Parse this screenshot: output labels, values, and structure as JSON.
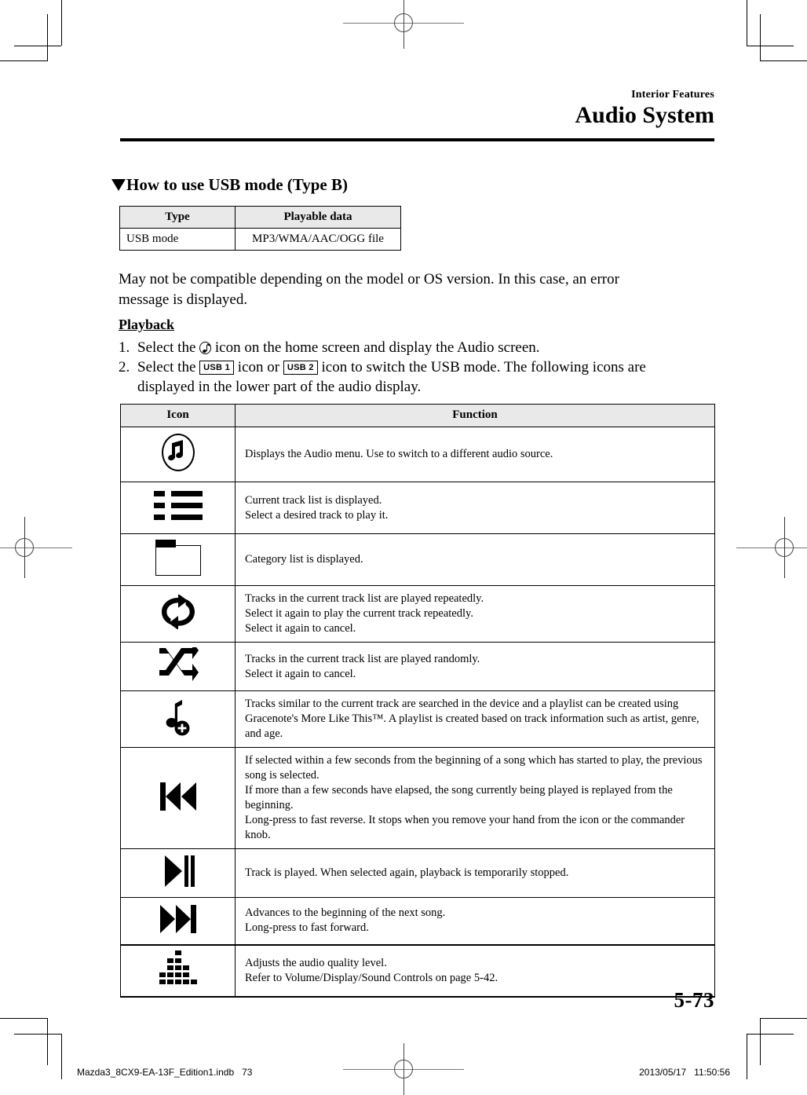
{
  "header": {
    "kicker": "Interior Features",
    "title": "Audio System"
  },
  "section": {
    "title": "How to use USB mode (Type B)",
    "bullet_icon": "triangle-down-icon"
  },
  "playable_table": {
    "columns": [
      "Type",
      "Playable data"
    ],
    "rows": [
      {
        "type": "USB mode",
        "data": "MP3/WMA/AAC/OGG file"
      }
    ]
  },
  "paragraph": "May not be compatible depending on the model or OS version. In this case, an error message is displayed.",
  "subhead": "Playback",
  "steps": [
    {
      "number": "1.",
      "pre": "Select the",
      "icon": "music-note-icon",
      "post": "icon on the home screen and display the Audio screen."
    },
    {
      "number": "2.",
      "pre": "Select the",
      "chip1": "USB 1",
      "mid1": "icon or",
      "chip2": "USB 2",
      "post": "icon to switch the USB mode. The following icons are displayed in the lower part of the audio display."
    }
  ],
  "function_table": {
    "columns": [
      "Icon",
      "Function"
    ],
    "rows": [
      {
        "icon": "circled-music-note-icon",
        "lines": [
          "Displays the Audio menu. Use to switch to a different audio source."
        ]
      },
      {
        "icon": "track-list-icon",
        "lines": [
          "Current track list is displayed.",
          "Select a desired track to play it."
        ]
      },
      {
        "icon": "folder-icon",
        "lines": [
          "Category list is displayed."
        ]
      },
      {
        "icon": "repeat-icon",
        "lines": [
          "Tracks in the current track list are played repeatedly.",
          "Select it again to play the current track repeatedly.",
          "Select it again to cancel."
        ]
      },
      {
        "icon": "shuffle-icon",
        "lines": [
          "Tracks in the current track list are played randomly.",
          "Select it again to cancel."
        ]
      },
      {
        "icon": "more-like-this-icon",
        "lines": [
          "Tracks similar to the current track are searched in the device and a playlist can be created using Gracenote's More Like This™. A playlist is created based on track information such as artist, genre, and age."
        ]
      },
      {
        "icon": "previous-track-icon",
        "lines": [
          "If selected within a few seconds from the beginning of a song which has started to play, the previous song is selected.",
          "If more than a few seconds have elapsed, the song currently being played is replayed from the beginning.",
          "Long-press to fast reverse. It stops when you remove your hand from the icon or the commander knob."
        ]
      },
      {
        "icon": "play-pause-icon",
        "lines": [
          "Track is played. When selected again, playback is temporarily stopped."
        ]
      },
      {
        "icon": "next-track-icon",
        "lines": [
          "Advances to the beginning of the next song.",
          "Long-press to fast forward."
        ]
      },
      {
        "icon": "equalizer-icon",
        "lines": [
          "Adjusts the audio quality level.",
          "Refer to Volume/Display/Sound Controls on page 5-42."
        ]
      }
    ]
  },
  "page_number": "5-73",
  "footer": {
    "left": "Mazda3_8CX9-EA-13F_Edition1.indb   73",
    "right": "2013/05/17   11:50:56"
  },
  "colors": {
    "text": "#000000",
    "table_header_bg": "#e9e9e9",
    "rule": "#000000"
  }
}
